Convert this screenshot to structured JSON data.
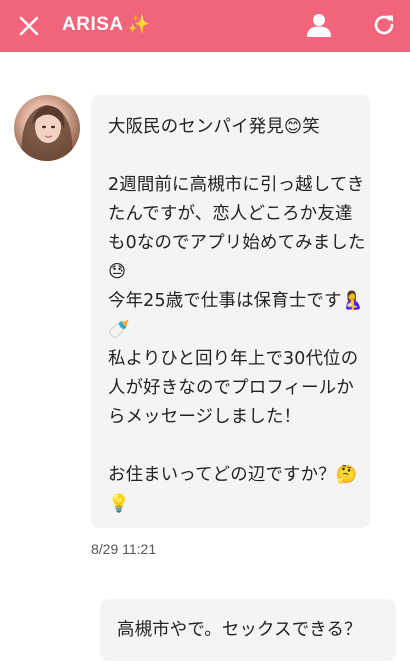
{
  "header": {
    "title": "ARISA",
    "title_emoji": "✨",
    "background_color": "#f2647b",
    "icons": [
      "close-icon",
      "user-profile-icon",
      "refresh-icon"
    ]
  },
  "messages": [
    {
      "direction": "incoming",
      "avatar": "profile-photo",
      "text": "大阪民のセンパイ発見😊笑\n\n2週間前に高槻市に引っ越してきたんですが、恋人どころか友達も0なのでアプリ始めてみました😓\n今年25歳で仕事は保育士です🤱🍼\n私よりひと回り年上で30代位の人が好きなのでプロフィールからメッセージしました！\n\nお住まいってどの辺ですか？🤔💡",
      "time": "8/29 11:21"
    },
    {
      "direction": "outgoing",
      "text": "高槻市やで。セックスできる？"
    }
  ]
}
